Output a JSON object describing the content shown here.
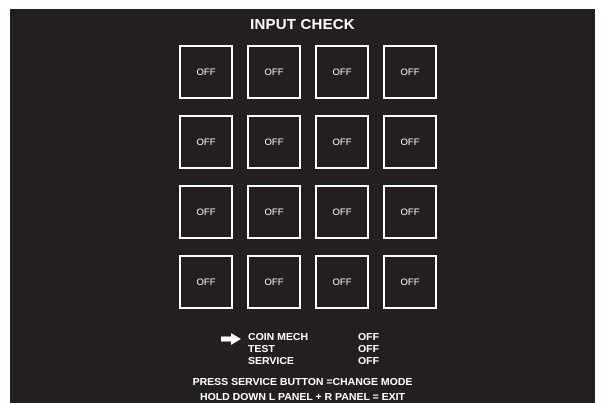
{
  "title": "INPUT CHECK",
  "pads": [
    {
      "label": "OFF"
    },
    {
      "label": "OFF"
    },
    {
      "label": "OFF"
    },
    {
      "label": "OFF"
    },
    {
      "label": "OFF"
    },
    {
      "label": "OFF"
    },
    {
      "label": "OFF"
    },
    {
      "label": "OFF"
    },
    {
      "label": "OFF"
    },
    {
      "label": "OFF"
    },
    {
      "label": "OFF"
    },
    {
      "label": "OFF"
    },
    {
      "label": "OFF"
    },
    {
      "label": "OFF"
    },
    {
      "label": "OFF"
    },
    {
      "label": "OFF"
    }
  ],
  "switches": [
    {
      "name": "COIN MECH",
      "state": "OFF",
      "selected": true
    },
    {
      "name": "TEST",
      "state": "OFF",
      "selected": false
    },
    {
      "name": "SERVICE",
      "state": "OFF",
      "selected": false
    }
  ],
  "pointer_icon": "arrow-right-icon",
  "footer": {
    "line1": "PRESS SERVICE BUTTON =CHANGE MODE",
    "line2": "HOLD DOWN L PANEL + R PANEL = EXIT"
  },
  "colors": {
    "background": "#231f20",
    "foreground": "#ffffff"
  }
}
